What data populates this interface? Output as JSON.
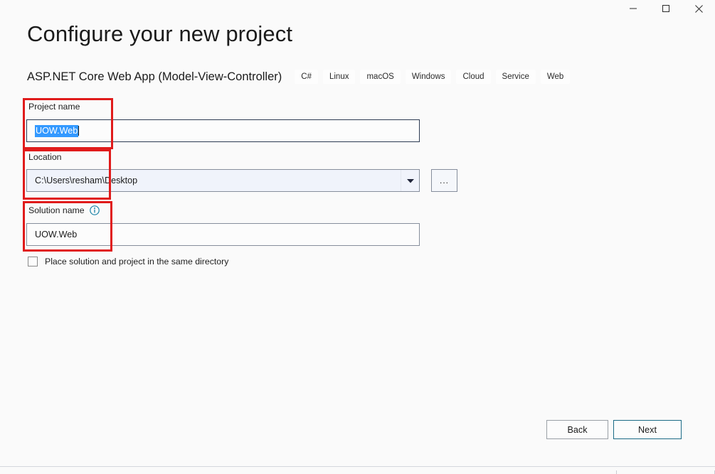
{
  "window": {
    "controls": [
      {
        "name": "minimize",
        "glyph": "minimize-icon"
      },
      {
        "name": "maximize",
        "glyph": "maximize-icon"
      },
      {
        "name": "close",
        "glyph": "close-icon"
      }
    ]
  },
  "header": {
    "title": "Configure your new project",
    "template_name": "ASP.NET Core Web App (Model-View-Controller)",
    "tags": [
      "C#",
      "Linux",
      "macOS",
      "Windows",
      "Cloud",
      "Service",
      "Web"
    ]
  },
  "form": {
    "project_name": {
      "label": "Project name",
      "value": "UOW.Web",
      "selected": true
    },
    "location": {
      "label": "Location",
      "value": "C:\\Users\\resham\\Desktop",
      "dropdown_icon": "chevron-down-icon",
      "browse_label": "..."
    },
    "solution_name": {
      "label": "Solution name",
      "info_icon": "info-icon",
      "value": "UOW.Web"
    },
    "same_directory": {
      "label": "Place solution and project in the same directory",
      "checked": false
    }
  },
  "footer": {
    "back_label": "Back",
    "next_label": "Next"
  },
  "colors": {
    "accent_primary": "#1b6b86",
    "selection_blue": "#3399ff",
    "annotation_red": "#e01b1b",
    "info_teal": "#1b83a8",
    "page_background": "#fafafa"
  }
}
